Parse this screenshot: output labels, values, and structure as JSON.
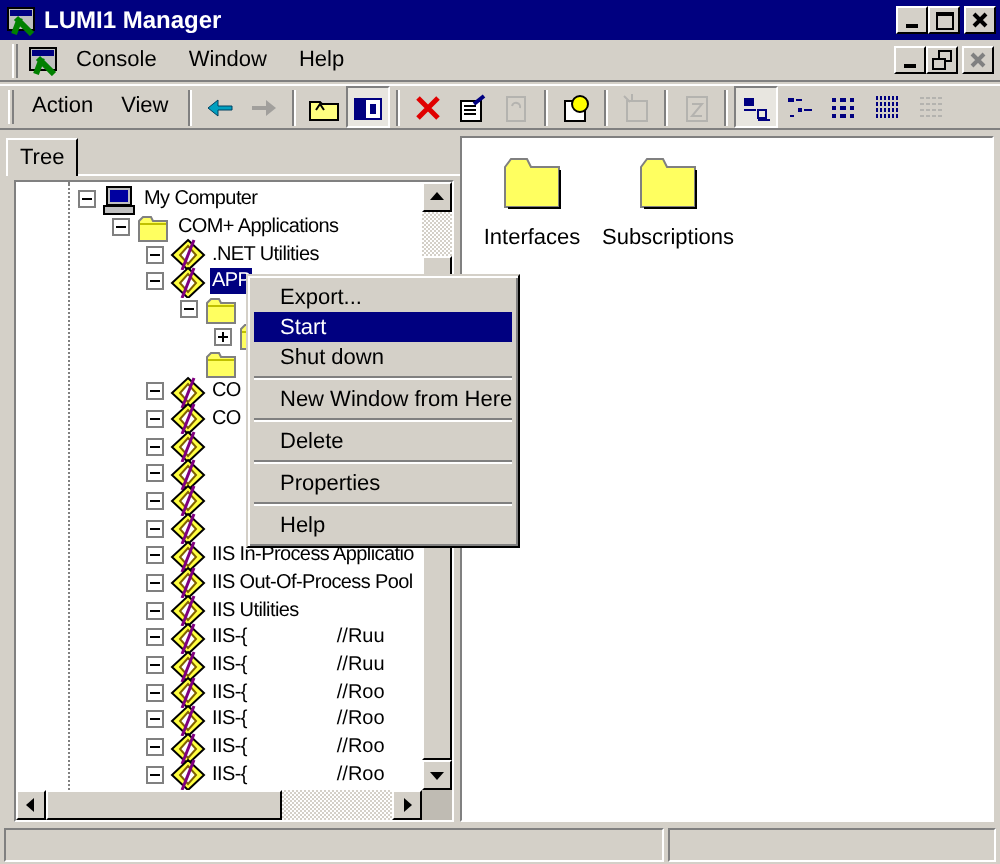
{
  "window": {
    "title": "LUMI1 Manager"
  },
  "menu_bar": {
    "items": [
      {
        "label": "Console"
      },
      {
        "label": "Window"
      },
      {
        "label": "Help"
      }
    ]
  },
  "toolbar": {
    "menus": [
      {
        "label": "Action"
      },
      {
        "label": "View"
      }
    ],
    "buttons": [
      {
        "kind": "back",
        "disabled": false,
        "pressed": false
      },
      {
        "kind": "forward",
        "disabled": true,
        "pressed": false
      },
      {
        "kind": "sep"
      },
      {
        "kind": "up",
        "disabled": false,
        "pressed": false
      },
      {
        "kind": "tree",
        "disabled": false,
        "pressed": true
      },
      {
        "kind": "sep"
      },
      {
        "kind": "delete",
        "disabled": false,
        "pressed": false
      },
      {
        "kind": "properties",
        "disabled": false,
        "pressed": false
      },
      {
        "kind": "refresh",
        "disabled": true,
        "pressed": false
      },
      {
        "kind": "sep"
      },
      {
        "kind": "help",
        "disabled": false,
        "pressed": false
      },
      {
        "kind": "sep"
      },
      {
        "kind": "new",
        "disabled": true,
        "pressed": false
      },
      {
        "kind": "sep"
      },
      {
        "kind": "export",
        "disabled": true,
        "pressed": false
      },
      {
        "kind": "sep"
      },
      {
        "kind": "large",
        "disabled": false,
        "pressed": true
      },
      {
        "kind": "small",
        "disabled": false,
        "pressed": false
      },
      {
        "kind": "list",
        "disabled": false,
        "pressed": false
      },
      {
        "kind": "detail",
        "disabled": false,
        "pressed": false
      },
      {
        "kind": "filter",
        "disabled": true,
        "pressed": false
      }
    ]
  },
  "tabs": [
    {
      "label": "Tree",
      "selected": true
    }
  ],
  "tree": [
    {
      "label": "My Computer",
      "kind": "computer",
      "expanded": true,
      "selected": false,
      "children": [
        {
          "label": "COM+ Applications",
          "kind": "folder",
          "expanded": true,
          "selected": false,
          "children": [
            {
              "label": ".NET Utilities",
              "kind": "app",
              "expanded": true,
              "selected": false
            },
            {
              "label": "APP",
              "kind": "app",
              "expanded": true,
              "selected": true,
              "children": [
                {
                  "kind": "folder",
                  "expanded": true,
                  "selected": false,
                  "children": [
                    {
                      "kind": "folder",
                      "expanded": false,
                      "selected": false
                    }
                  ]
                },
                {
                  "kind": "folder",
                  "selected": false
                }
              ]
            },
            {
              "label": "CO",
              "kind": "app",
              "expanded": true,
              "selected": false
            },
            {
              "label": "CO",
              "kind": "app",
              "expanded": true,
              "selected": false
            },
            {
              "kind": "app",
              "expanded": true,
              "selected": false
            },
            {
              "kind": "app",
              "expanded": true,
              "selected": false
            },
            {
              "kind": "app",
              "expanded": true,
              "selected": false
            },
            {
              "kind": "app",
              "expanded": true,
              "selected": false
            },
            {
              "label": "IIS In-Process Applicatio",
              "kind": "app",
              "expanded": true,
              "selected": false
            },
            {
              "label": "IIS Out-Of-Process Pool",
              "kind": "app",
              "expanded": true,
              "selected": false
            },
            {
              "label": "IIS Utilities",
              "kind": "app",
              "expanded": true,
              "selected": false
            },
            {
              "label": "IIS-{",
              "label_end": "//Ruu",
              "kind": "app",
              "expanded": true,
              "selected": false
            },
            {
              "label": "IIS-{",
              "label_end": "//Ruu",
              "kind": "app",
              "expanded": true,
              "selected": false
            },
            {
              "label": "IIS-{",
              "label_end": "//Roo",
              "kind": "app",
              "expanded": true,
              "selected": false
            },
            {
              "label": "IIS-{",
              "label_end": "//Roo",
              "kind": "app",
              "expanded": true,
              "selected": false
            },
            {
              "label": "IIS-{",
              "label_end": "//Roo",
              "kind": "app",
              "expanded": true,
              "selected": false
            },
            {
              "label": "IIS-{",
              "label_end": "//Roo",
              "kind": "app",
              "expanded": true,
              "selected": false
            }
          ]
        }
      ]
    }
  ],
  "context_menu": {
    "items": [
      {
        "kind": "item",
        "label": "Export...",
        "selected": false
      },
      {
        "kind": "item",
        "label": "Start",
        "selected": true
      },
      {
        "kind": "item",
        "label": "Shut down",
        "selected": false
      },
      {
        "kind": "sep"
      },
      {
        "kind": "item",
        "label": "New Window from Here",
        "selected": false
      },
      {
        "kind": "sep"
      },
      {
        "kind": "item",
        "label": "Delete",
        "selected": false
      },
      {
        "kind": "sep"
      },
      {
        "kind": "item",
        "label": "Properties",
        "selected": false
      },
      {
        "kind": "sep"
      },
      {
        "kind": "item",
        "label": "Help",
        "selected": false
      }
    ]
  },
  "details": {
    "items": [
      {
        "label": "Interfaces"
      },
      {
        "label": "Subscriptions"
      }
    ]
  }
}
